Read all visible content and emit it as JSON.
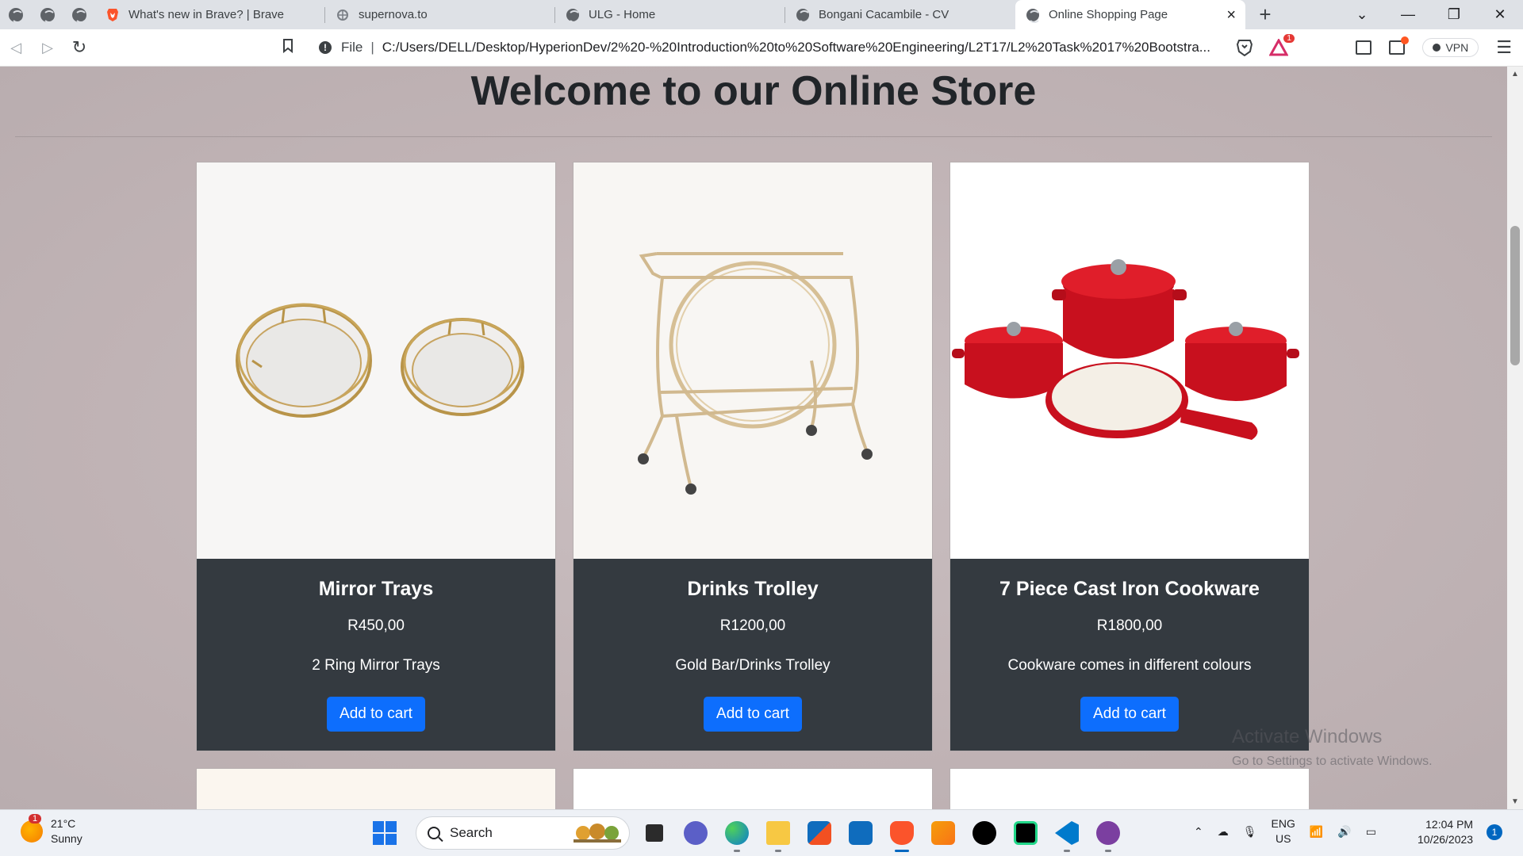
{
  "browser": {
    "tabs": [
      {
        "label": "What's new in Brave? | Brave"
      },
      {
        "label": "supernova.to"
      },
      {
        "label": "ULG - Home"
      },
      {
        "label": "Bongani Cacambile - CV"
      },
      {
        "label": "Online Shopping Page"
      }
    ],
    "address": {
      "scheme_label": "File",
      "url": "C:/Users/DELL/Desktop/HyperionDev/2%20-%20Introduction%20to%20Software%20Engineering/L2T17/L2%20Task%2017%20Bootstra..."
    },
    "rewards_badge": "1",
    "vpn_label": "VPN"
  },
  "page": {
    "title": "Welcome to our Online Store",
    "products": [
      {
        "name": "Mirror Trays",
        "price": "R450,00",
        "description": "2 Ring Mirror Trays",
        "button": "Add to cart"
      },
      {
        "name": "Drinks Trolley",
        "price": "R1200,00",
        "description": "Gold Bar/Drinks Trolley",
        "button": "Add to cart"
      },
      {
        "name": "7 Piece Cast Iron Cookware",
        "price": "R1800,00",
        "description": "Cookware comes in different colours",
        "button": "Add to cart"
      }
    ],
    "watermark": {
      "line1": "Activate Windows",
      "line2": "Go to Settings to activate Windows."
    }
  },
  "taskbar": {
    "weather_temp": "21°C",
    "weather_cond": "Sunny",
    "weather_badge": "1",
    "search_placeholder": "Search",
    "lang_line1": "ENG",
    "lang_line2": "US",
    "time": "12:04 PM",
    "date": "10/26/2023",
    "notification_count": "1"
  },
  "colors": {
    "page_bg": "#c2b6b8",
    "card_body": "#343a40",
    "button": "#0d6efd",
    "tab_strip": "#dee1e6"
  }
}
